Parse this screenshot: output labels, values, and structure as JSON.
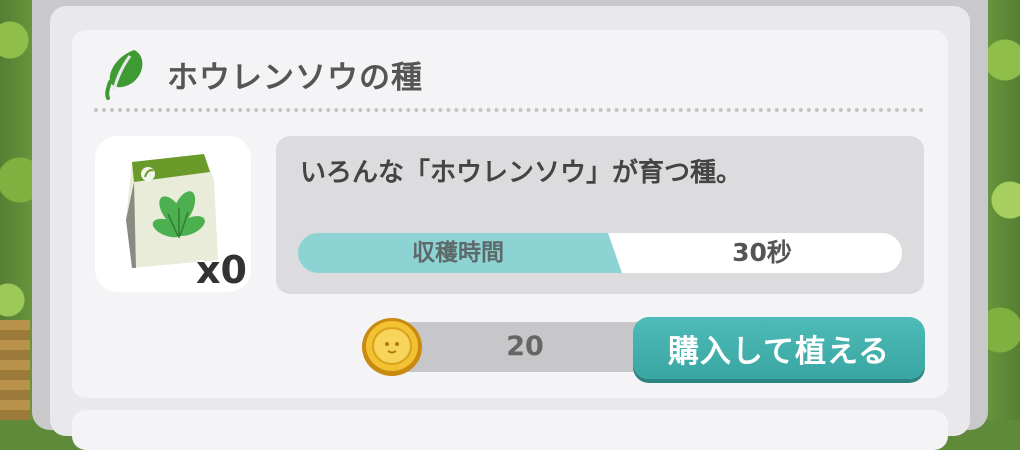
{
  "item": {
    "title": "ホウレンソウの種",
    "quantity": "x0",
    "description": "いろんな「ホウレンソウ」が育つ種。",
    "icon": "leaf-icon",
    "image": "spinach-seed-bag"
  },
  "harvest": {
    "label": "収穫時間",
    "value": "30秒"
  },
  "purchase": {
    "price": "20",
    "currency_icon": "coin-icon",
    "button_label": "購入して植える"
  },
  "colors": {
    "accent": "#3aa6a3",
    "harvest_label_bg": "#8dd3d4",
    "leaf_green": "#3f9a34"
  }
}
